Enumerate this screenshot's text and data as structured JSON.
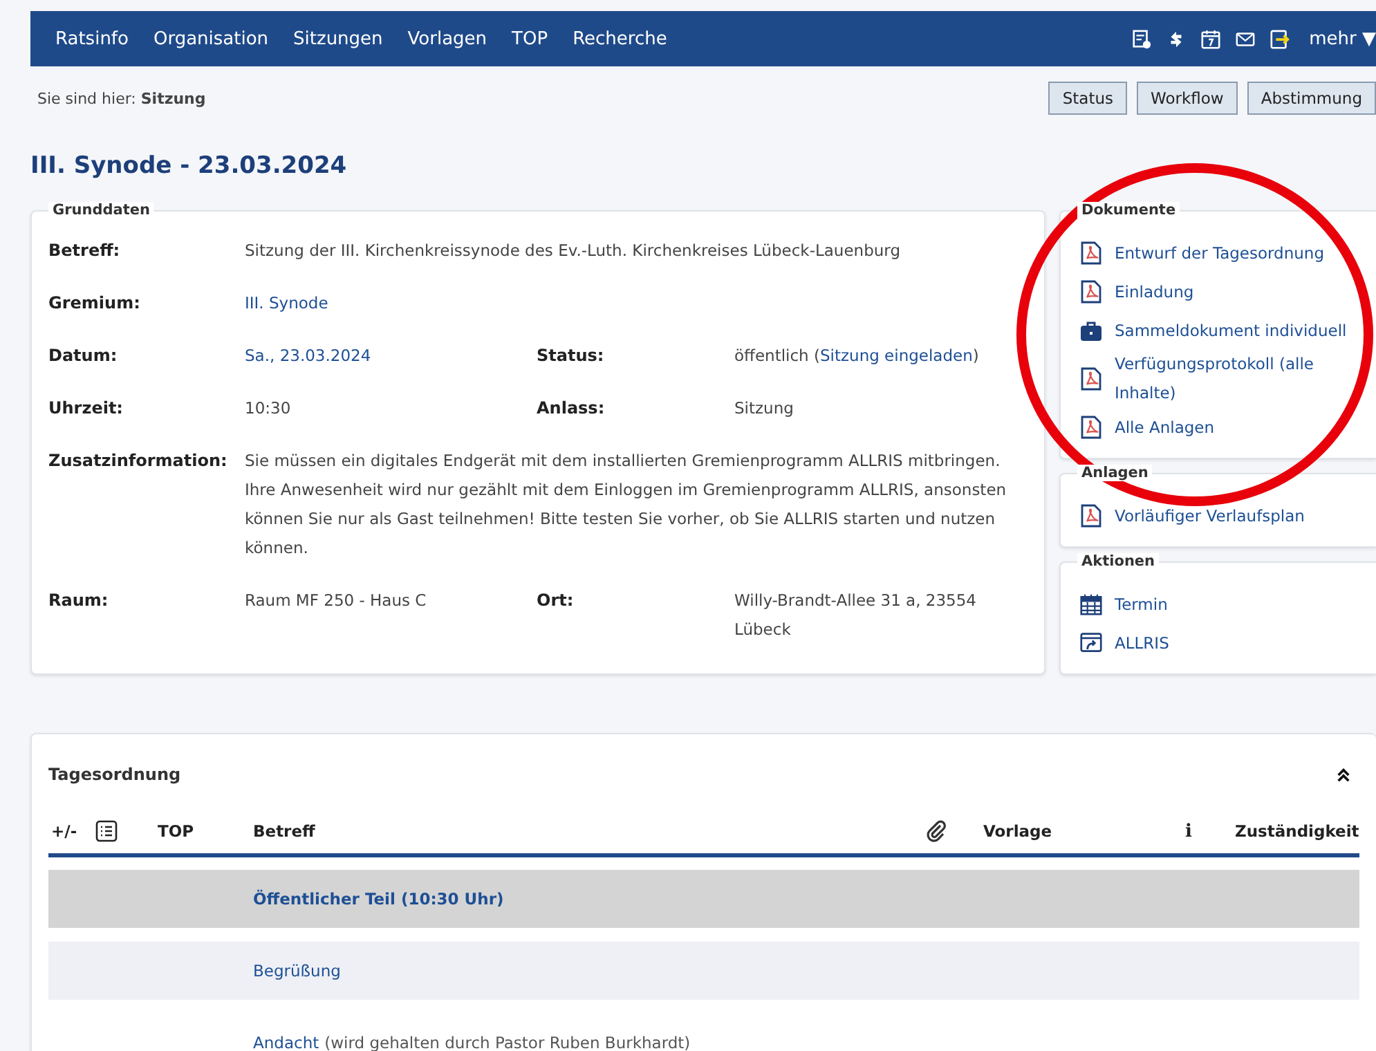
{
  "nav": {
    "items": [
      "Ratsinfo",
      "Organisation",
      "Sitzungen",
      "Vorlagen",
      "TOP",
      "Recherche"
    ],
    "more": "mehr ▼"
  },
  "breadcrumb": {
    "prefix": "Sie sind hier:",
    "current": "Sitzung"
  },
  "buttons": [
    "Status",
    "Workflow",
    "Abstimmung"
  ],
  "title": "III. Synode - 23.03.2024",
  "grunddaten": {
    "legend": "Grunddaten",
    "rows": [
      {
        "label": "Betreff:",
        "value": [
          {
            "text": "Sitzung der III. Kirchenkreissynode des Ev.-Luth. Kirchenkreises Lübeck-Lauenburg",
            "link": false
          }
        ]
      },
      {
        "label": "Gremium:",
        "value": [
          {
            "text": "III. Synode",
            "link": true
          }
        ]
      },
      {
        "label": "Datum:",
        "value": [
          {
            "text": "Sa., 23.03.2024",
            "link": true
          }
        ],
        "label2": "Status:",
        "value2": [
          {
            "text": "öffentlich (",
            "link": false
          },
          {
            "text": "Sitzung eingeladen",
            "link": true
          },
          {
            "text": ")",
            "link": false
          }
        ]
      },
      {
        "label": "Uhrzeit:",
        "value": [
          {
            "text": "10:30",
            "link": false
          }
        ],
        "label2": "Anlass:",
        "value2": [
          {
            "text": "Sitzung",
            "link": false
          }
        ]
      },
      {
        "label": "Zusatzinformation:",
        "value": [
          {
            "text": "Sie müssen ein digitales Endgerät mit dem installierten Gremienprogramm ALLRIS mitbringen. Ihre Anwesenheit wird nur gezählt mit dem Einloggen im Gremienprogramm ALLRIS, ansonsten können Sie nur als Gast teilnehmen! Bitte testen Sie vorher, ob Sie ALLRIS starten und nutzen können.",
            "link": false
          }
        ]
      },
      {
        "label": "Raum:",
        "value": [
          {
            "text": "Raum MF 250 - Haus C",
            "link": false
          }
        ],
        "label2": "Ort:",
        "value2": [
          {
            "text": "Willy-Brandt-Allee 31 a, 23554 Lübeck",
            "link": false
          }
        ]
      }
    ]
  },
  "side": [
    {
      "legend": "Dokumente",
      "items": [
        {
          "kind": "pdf",
          "label": "Entwurf der Tagesordnung"
        },
        {
          "kind": "pdf",
          "label": "Einladung"
        },
        {
          "kind": "bag",
          "label": "Sammeldokument individuell"
        },
        {
          "kind": "pdf",
          "label": "Verfügungsprotokoll (alle Inhalte)"
        },
        {
          "kind": "pdf",
          "label": "Alle Anlagen"
        }
      ]
    },
    {
      "legend": "Anlagen",
      "items": [
        {
          "kind": "pdf",
          "label": "Vorläufiger Verlaufsplan"
        }
      ]
    },
    {
      "legend": "Aktionen",
      "items": [
        {
          "kind": "calendar",
          "label": "Termin"
        },
        {
          "kind": "export",
          "label": "ALLRIS"
        }
      ]
    }
  ],
  "agenda": {
    "title": "Tagesordnung",
    "columns": {
      "toggle": "+/-",
      "top": "TOP",
      "betreff": "Betreff",
      "vorlage": "Vorlage",
      "info": "i",
      "zust": "Zuständigkeit"
    },
    "rows": [
      {
        "kind": "section",
        "betreff": "Öffentlicher Teil (10:30 Uhr)"
      },
      {
        "kind": "item",
        "betreff": "Begrüßung"
      },
      {
        "kind": "item",
        "betreff": "Andacht",
        "note": "(wird gehalten durch Pastor Ruben Burkhardt)"
      }
    ]
  }
}
